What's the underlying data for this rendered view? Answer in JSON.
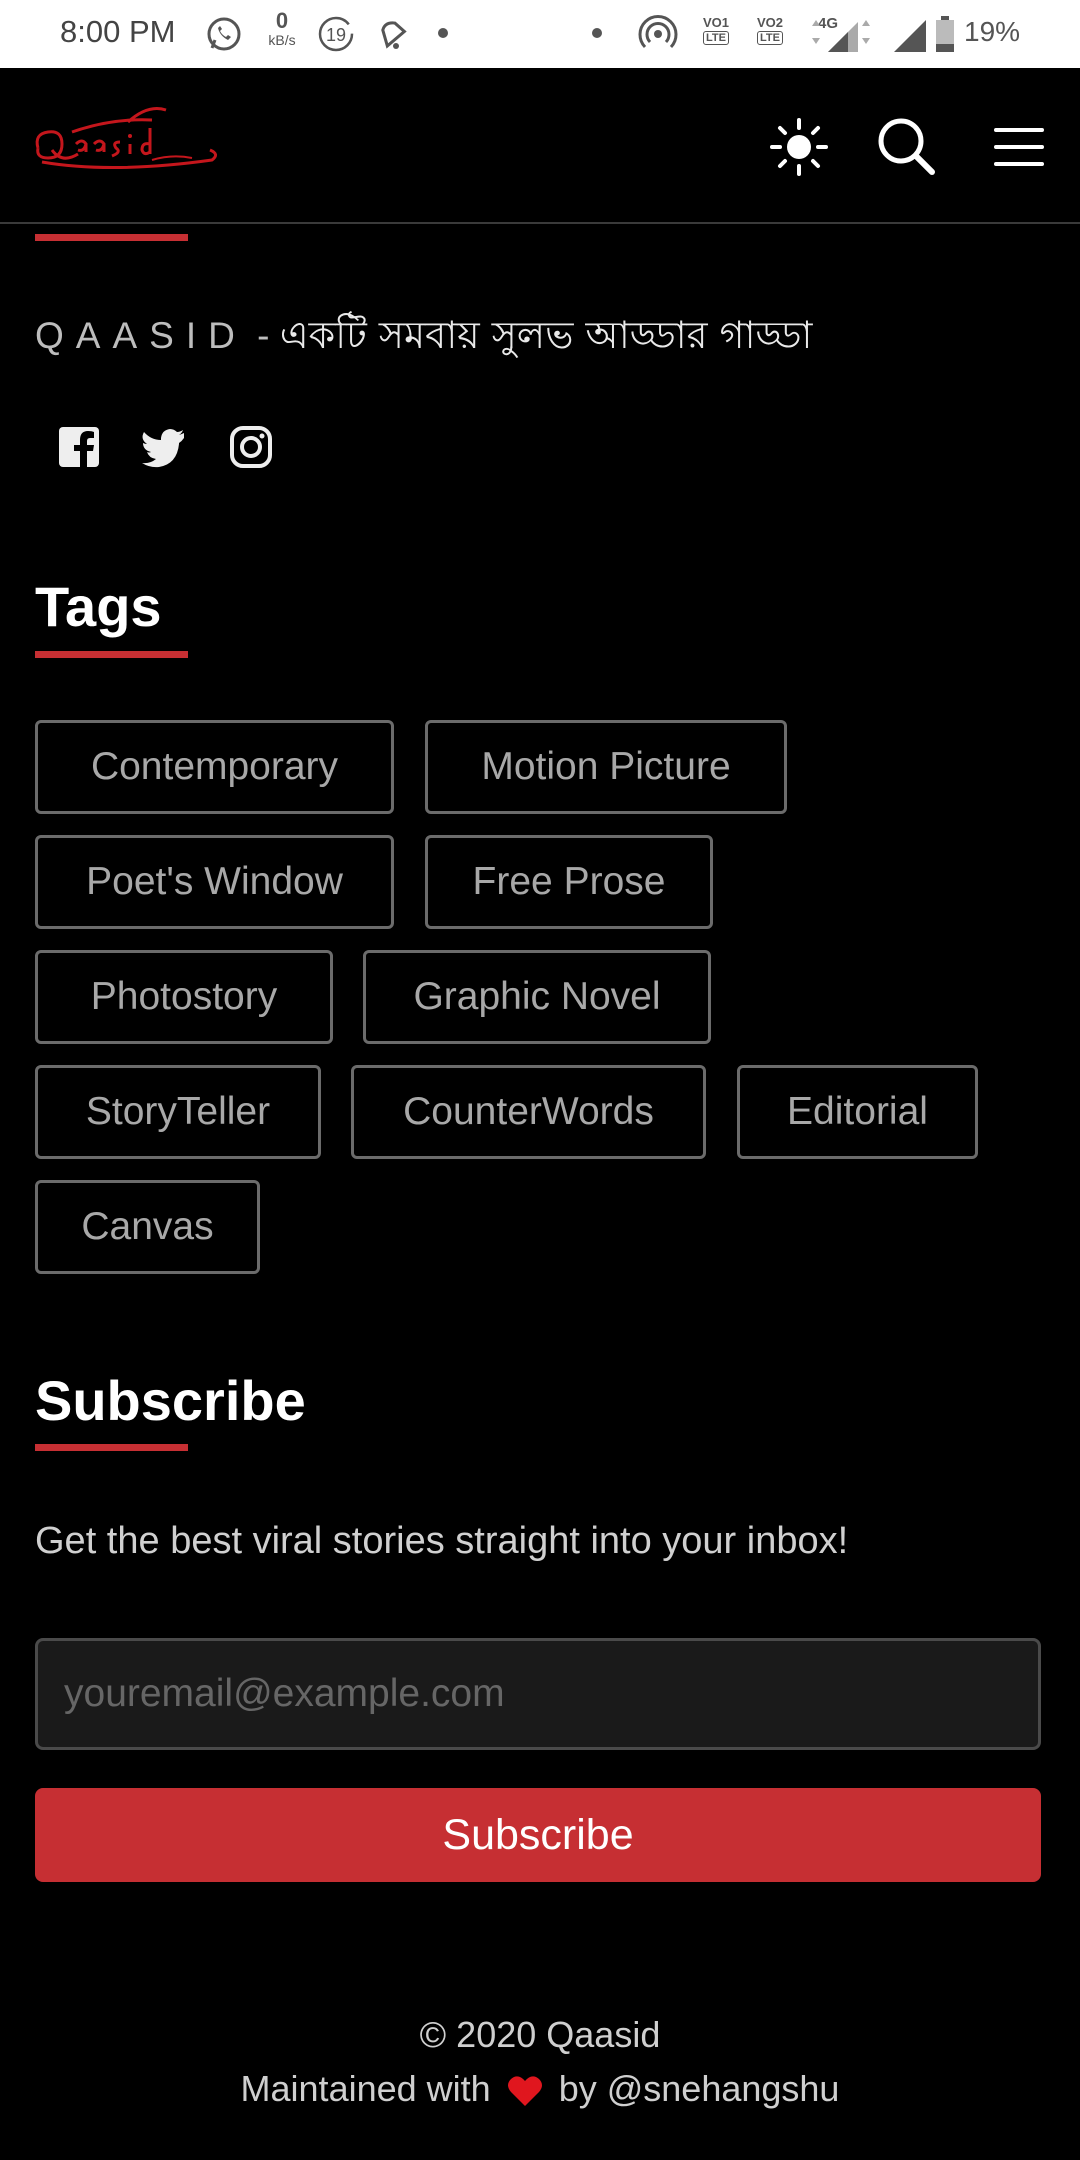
{
  "status_bar": {
    "time": "8:00 PM",
    "net_speed_value": "0",
    "net_speed_unit": "kB/s",
    "notification_count": "19",
    "vo1_label": "VO1",
    "vo1_sub": "LTE",
    "vo2_label": "VO2",
    "vo2_sub": "LTE",
    "network_type": "4G",
    "battery_percent": "19%"
  },
  "header": {
    "logo_alt": "Qaasid",
    "icons": [
      "sun-icon",
      "search-icon",
      "hamburger-menu-icon"
    ]
  },
  "about": {
    "brand": "QAASID",
    "separator": " - ",
    "tagline": "একটি সমবায় সুলভ আড্ডার গাড্ডা",
    "social": [
      "facebook-icon",
      "twitter-icon",
      "instagram-icon"
    ]
  },
  "tags": {
    "title": "Tags",
    "items": [
      "Contemporary",
      "Motion Picture",
      "Poet's Window",
      "Free Prose",
      "Photostory",
      "Graphic Novel",
      "StoryTeller",
      "CounterWords",
      "Editorial",
      "Canvas"
    ]
  },
  "subscribe": {
    "title": "Subscribe",
    "description": "Get the best viral stories straight into your inbox!",
    "email_placeholder": "youremail@example.com",
    "email_value": "",
    "button_label": "Subscribe"
  },
  "footer": {
    "copyright": "© 2020 Qaasid",
    "maintained_prefix": "Maintained with",
    "maintained_suffix": "by @snehangshu"
  },
  "colors": {
    "accent": "#c62f33",
    "background": "#000000",
    "tag_border": "#6b6b6b"
  }
}
